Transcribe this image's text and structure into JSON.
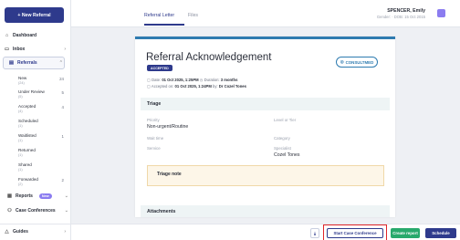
{
  "sidebar": {
    "new_referral": "+ New Referral",
    "dashboard": "Dashboard",
    "inbox": "Inbox",
    "referrals": "Referrals",
    "items": [
      {
        "label": "New",
        "count": "(24)",
        "num": "24"
      },
      {
        "label": "Under Review",
        "count": "(5)",
        "num": "5"
      },
      {
        "label": "Accepted",
        "count": "(4)",
        "num": "4"
      },
      {
        "label": "Scheduled",
        "count": "(1)",
        "num": ""
      },
      {
        "label": "Waitlisted",
        "count": "(1)",
        "num": "1"
      },
      {
        "label": "Returned",
        "count": "(1)",
        "num": ""
      },
      {
        "label": "Shared",
        "count": "(1)",
        "num": ""
      },
      {
        "label": "Forwarded",
        "count": "(2)",
        "num": "2"
      }
    ],
    "reports": "Reports",
    "reports_badge": "New",
    "case_conferences": "Case Conferences",
    "guides": "Guides"
  },
  "topbar": {
    "tab_letter": "Referral Letter",
    "tab_files": "Files",
    "patient_name": "SPENCER, Emily",
    "patient_meta": "Gender: · DOB: 15 Oct 2015"
  },
  "document": {
    "title": "Referral Acknowledgement",
    "status": "ACCEPTED",
    "consulted_label": "CONSULTMED",
    "date_label": "Date:",
    "date_value": "01 Oct 2025, 1:25PM",
    "duration_label": "Duration:",
    "duration_value": "3 months",
    "accepted_label": "Accepted on:",
    "accepted_value": "01 Oct 2025, 1:24PM",
    "accepted_by_label": "by:",
    "accepted_by_value": "Dr Cozel Tones",
    "triage_heading": "Triage",
    "priority_label": "Priority",
    "priority_value": "Non-urgent/Routine",
    "level_label": "Level or Tier",
    "wait_label": "Wait time",
    "category_label": "Category",
    "service_label": "Service",
    "specialist_label": "Specialist",
    "specialist_value": "Cozel Tones",
    "triage_note": "Triage note",
    "attachments_heading": "Attachments"
  },
  "actions": {
    "download_icon": "⤓",
    "start_case_conference": "Start Case Conference",
    "create_report": "Create report",
    "schedule": "Schedule"
  },
  "colors": {
    "primary": "#2e3a8c",
    "accent_green": "#28a96c",
    "highlight_red": "#e0262a",
    "purple": "#8b7cf0"
  }
}
